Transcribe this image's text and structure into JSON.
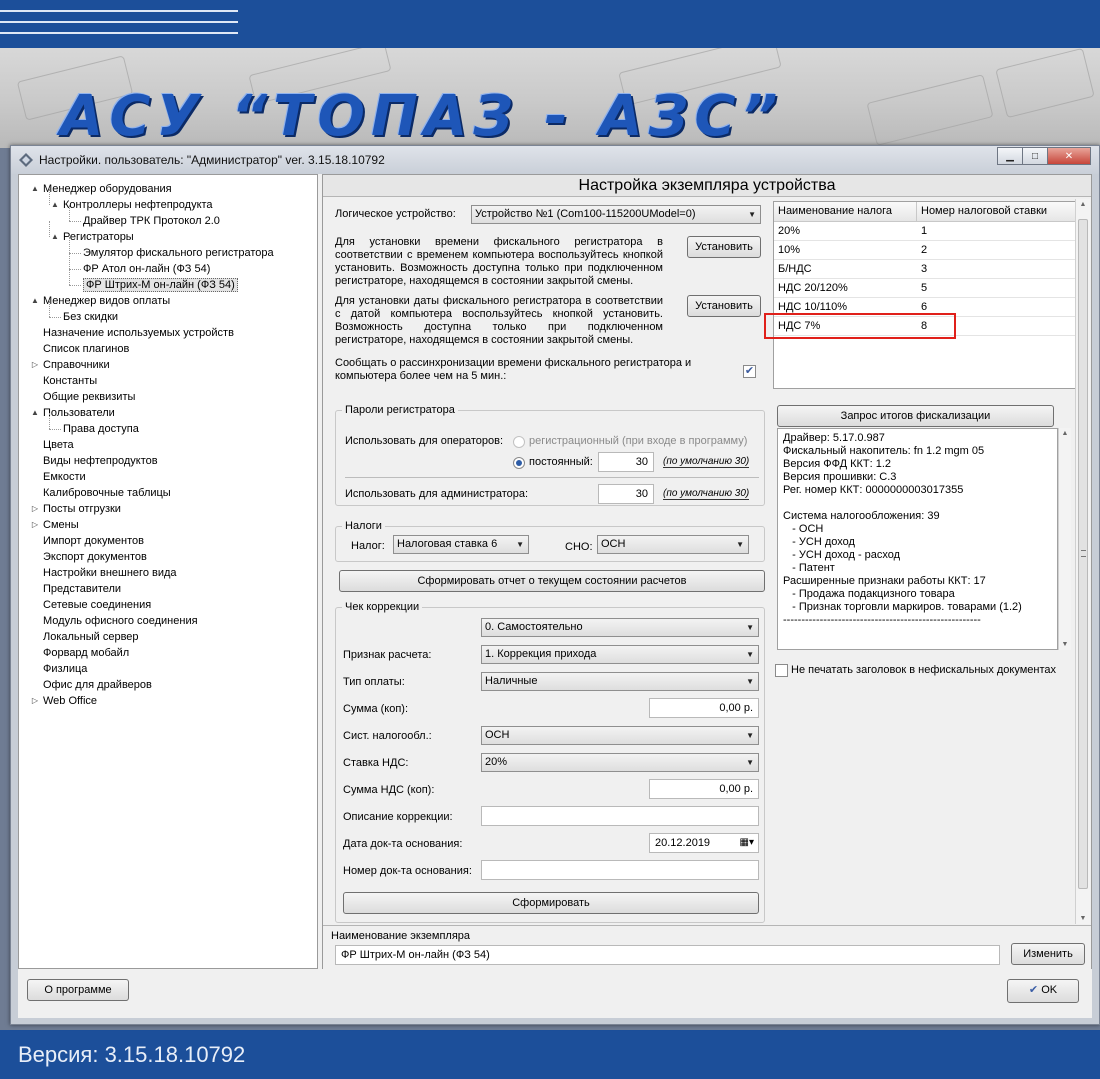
{
  "banner": {
    "title": "АСУ “ТОПАЗ - АЗС”"
  },
  "footer": {
    "version": "Версия: 3.15.18.10792"
  },
  "window": {
    "title": "Настройки. пользователь: \"Администратор\" ver. 3.15.18.10792",
    "icons": {
      "app": "settings-diamond-icon",
      "minimize": "minimize-icon",
      "maximize": "maximize-icon",
      "close": "close-icon"
    },
    "about_label": "О программе",
    "ok_label": "OK"
  },
  "tree": [
    {
      "label": "Менеджер оборудования",
      "glyph": "▲"
    },
    {
      "label": "Контроллеры нефтепродукта",
      "glyph": "▲"
    },
    {
      "label": "Драйвер ТРК Протокол 2.0",
      "glyph": ""
    },
    {
      "label": "Регистраторы",
      "glyph": "▲"
    },
    {
      "label": "Эмулятор фискального регистратора",
      "glyph": ""
    },
    {
      "label": "ФР Атол он-лайн (ФЗ 54)",
      "glyph": ""
    },
    {
      "label": "ФР Штрих-М он-лайн (ФЗ 54)",
      "glyph": "",
      "selected": true
    },
    {
      "label": "Менеджер видов оплаты",
      "glyph": "▲"
    },
    {
      "label": "Без скидки",
      "glyph": ""
    },
    {
      "label": "Назначение используемых устройств",
      "glyph": ""
    },
    {
      "label": "Список плагинов",
      "glyph": ""
    },
    {
      "label": "Справочники",
      "glyph": "▷"
    },
    {
      "label": "Константы",
      "glyph": ""
    },
    {
      "label": "Общие реквизиты",
      "glyph": ""
    },
    {
      "label": "Пользователи",
      "glyph": "▲"
    },
    {
      "label": "Права доступа",
      "glyph": ""
    },
    {
      "label": "Цвета",
      "glyph": ""
    },
    {
      "label": "Виды нефтепродуктов",
      "glyph": ""
    },
    {
      "label": "Емкости",
      "glyph": ""
    },
    {
      "label": "Калибровочные таблицы",
      "glyph": ""
    },
    {
      "label": "Посты отгрузки",
      "glyph": "▷"
    },
    {
      "label": "Смены",
      "glyph": "▷"
    },
    {
      "label": "Импорт документов",
      "glyph": ""
    },
    {
      "label": "Экспорт документов",
      "glyph": ""
    },
    {
      "label": "Настройки внешнего вида",
      "glyph": ""
    },
    {
      "label": "Представители",
      "glyph": ""
    },
    {
      "label": "Сетевые соединения",
      "glyph": ""
    },
    {
      "label": "Модуль офисного соединения",
      "glyph": ""
    },
    {
      "label": "Локальный сервер",
      "glyph": ""
    },
    {
      "label": "Форвард мобайл",
      "glyph": ""
    },
    {
      "label": "Физлица",
      "glyph": ""
    },
    {
      "label": "Офис для драйверов",
      "glyph": ""
    },
    {
      "label": "Web Office",
      "glyph": "▷"
    }
  ],
  "panel": {
    "header": "Настройка экземпляра устройства",
    "logical_device_label": "Логическое устройство:",
    "logical_device_value": "Устройство №1 (Com100-115200UModel=0)",
    "time_text": "Для установки времени фискального регистратора в соответствии с временем компьютера воспользуйтесь кнопкой установить. Возможность доступна только при подключенном регистраторе, находящемся в состоянии закрытой смены.",
    "date_text": "Для установки даты фискального регистратора в соответствии с датой компьютера воспользуйтесь кнопкой установить. Возможность доступна только при подключенном регистраторе, находящемся в состоянии закрытой смены.",
    "set_time_button": "Установить",
    "set_date_button": "Установить",
    "desync_text": "Сообщать о рассинхронизации времени фискального регистратора и компьютера более чем на 5 мин.:",
    "desync_checked": true,
    "passwords": {
      "title": "Пароли регистратора",
      "operators_label": "Использовать для операторов:",
      "option_registration": "регистрационный (при входе в программу)",
      "option_permanent": "постоянный:",
      "permanent_value": "30",
      "default_hint": "(по умолчанию 30)",
      "admin_label": "Использовать для администратора:",
      "admin_value": "30",
      "admin_hint": "(по умолчанию 30)"
    },
    "taxes": {
      "title": "Налоги",
      "tax_label": "Налог:",
      "tax_value": "Налоговая ставка 6",
      "sno_label": "СНО:",
      "sno_value": "ОСН"
    },
    "report_button": "Сформировать отчет о текущем состоянии расчетов",
    "correction": {
      "title": "Чек коррекции",
      "mode_value": "0. Самостоятельно",
      "calc_sign_label": "Признак расчета:",
      "calc_sign_value": "1. Коррекция прихода",
      "payment_type_label": "Тип оплаты:",
      "payment_type_value": "Наличные",
      "sum_label": "Сумма (коп):",
      "sum_value": "0,00 р.",
      "tax_system_label": "Сист. налогообл.:",
      "tax_system_value": "ОСН",
      "vat_rate_label": "Ставка НДС:",
      "vat_rate_value": "20%",
      "vat_sum_label": "Сумма НДС (коп):",
      "vat_sum_value": "0,00 р.",
      "description_label": "Описание коррекции:",
      "description_value": "",
      "doc_date_label": "Дата док-та основания:",
      "doc_date_value": "20.12.2019",
      "doc_number_label": "Номер док-та основания:",
      "doc_number_value": "",
      "create_button": "Сформировать"
    },
    "tax_table": {
      "headers": [
        "Наименование налога",
        "Номер налоговой ставки"
      ],
      "rows": [
        [
          "20%",
          "1"
        ],
        [
          "10%",
          "2"
        ],
        [
          "Б/НДС",
          "3"
        ],
        [
          "НДС 20/120%",
          "5"
        ],
        [
          "НДС 10/110%",
          "6"
        ],
        [
          "НДС 7%",
          "8"
        ]
      ]
    },
    "fiscal_button": "Запрос итогов фискализации",
    "fiscal_info": [
      "Драйвер: 5.17.0.987",
      "Фискальный накопитель: fn 1.2 mgm 05",
      "Версия ФФД ККТ: 1.2",
      "Версия прошивки: C.3",
      "Рег. номер ККТ: 0000000003017355",
      "",
      "Система налогообложения: 39",
      "   - ОСН",
      "   - УСН доход",
      "   - УСН доход - расход",
      "   - Патент",
      "Расширенные признаки работы ККТ: 17",
      "   - Продажа подакцизного товара",
      "   - Признак торговли маркиров. товарами (1.2)",
      "------------------------------------------------------"
    ],
    "no_header_label": "Не печатать заголовок в нефискальных документах",
    "instance_name_label": "Наименование экземпляра",
    "instance_name_value": "ФР Штрих-М он-лайн (ФЗ 54)",
    "change_button": "Изменить"
  }
}
